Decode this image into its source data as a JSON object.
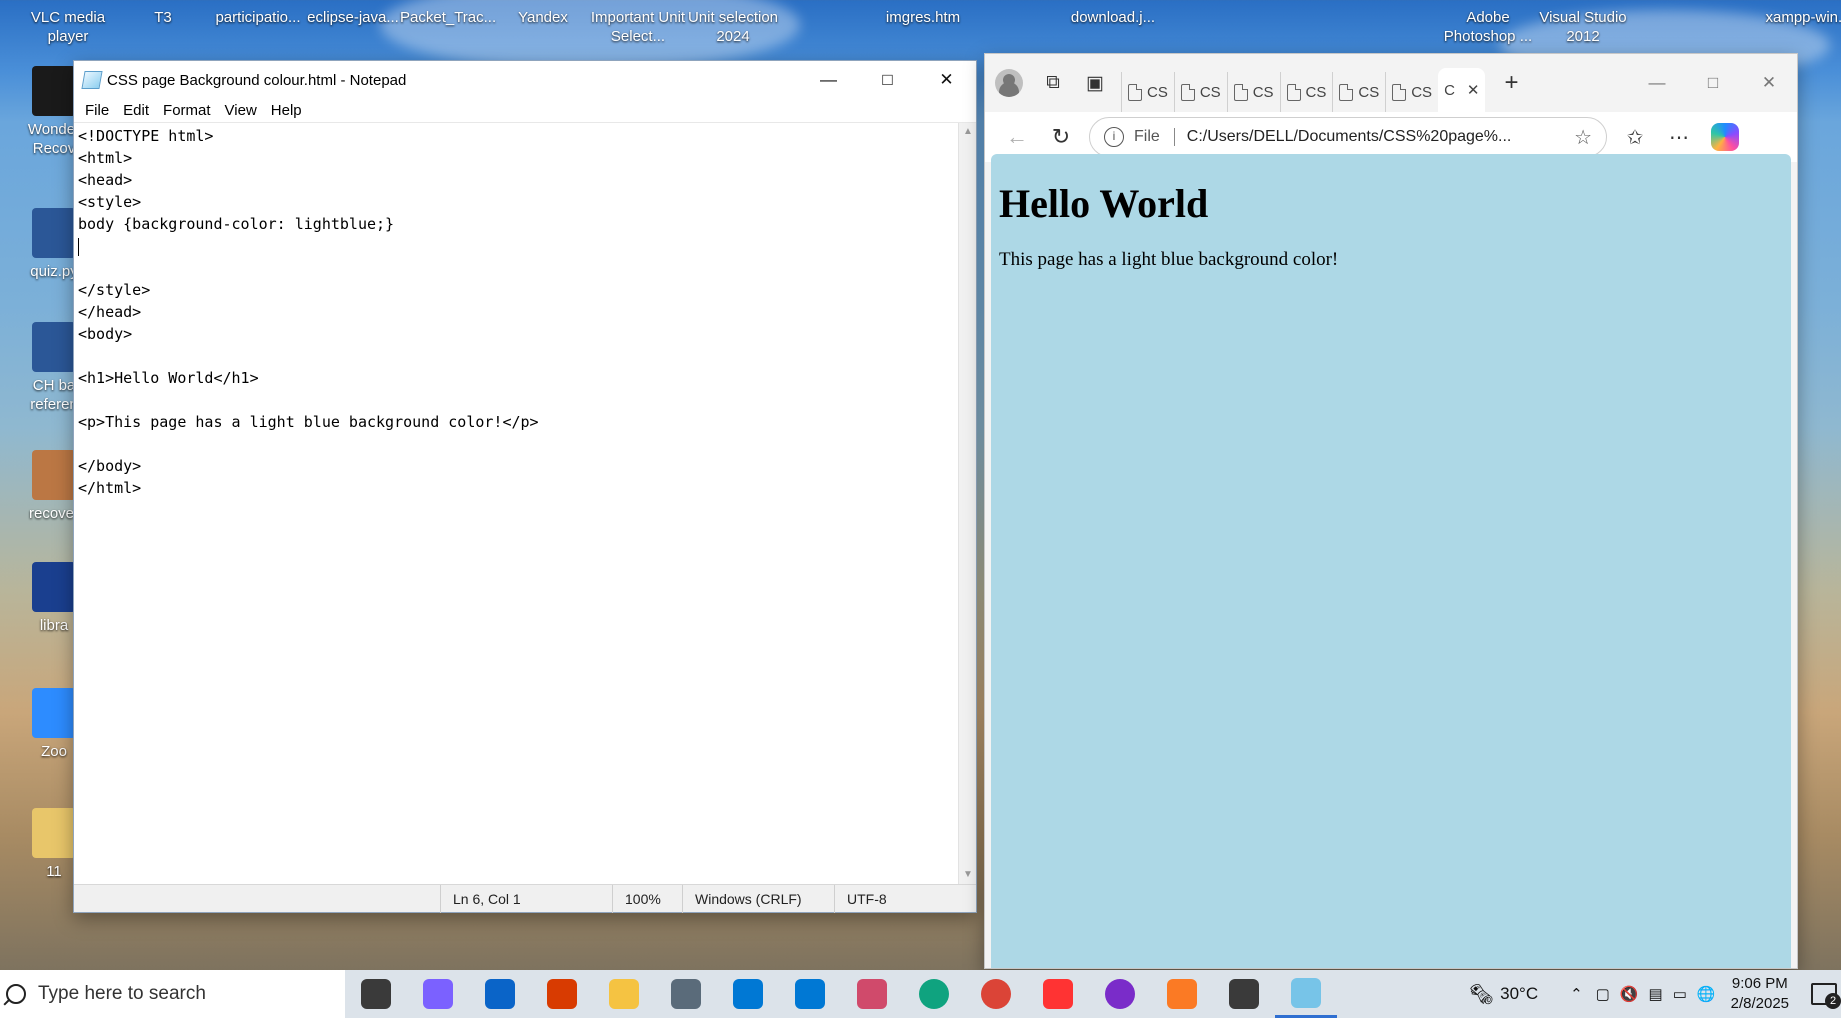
{
  "desktop": {
    "top_icons": [
      {
        "label": "VLC media player",
        "color": "#ff8800"
      },
      {
        "label": "T3",
        "color": "#f0c14b"
      },
      {
        "label": "participatio...",
        "color": "#2b5797"
      },
      {
        "label": "eclipse-java...",
        "color": "#2c2255"
      },
      {
        "label": "Packet_Trac...",
        "color": "#1b5fa8"
      },
      {
        "label": "Yandex",
        "color": "#ffffff"
      },
      {
        "label": "Important Unit Select...",
        "color": "#2b5797"
      },
      {
        "label": "Unit selection 2024",
        "color": "#2b5797"
      },
      {
        "label": "imgres.htm",
        "color": "#ffffff"
      },
      {
        "label": "download.j...",
        "color": "#ffffff"
      },
      {
        "label": "Adobe Photoshop ...",
        "color": "#31a8ff"
      },
      {
        "label": "Visual Studio 2012",
        "color": "#68217a"
      },
      {
        "label": "xampp-win...",
        "color": "#fb7a24"
      }
    ],
    "left_icons": [
      {
        "label": "Wonder Recov",
        "color": "#1a1a1a"
      },
      {
        "label": "quiz.py",
        "color": "#2b5797"
      },
      {
        "label": "CH ba referen",
        "color": "#2b5797"
      },
      {
        "label": "recover",
        "color": "#bb7744"
      },
      {
        "label": "libra",
        "color": "#1a3f8f"
      },
      {
        "label": "Zoo",
        "color": "#2d8cff"
      },
      {
        "label": "11",
        "color": "#e8c66a"
      }
    ]
  },
  "notepad": {
    "title": "CSS page Background colour.html - Notepad",
    "menu": [
      "File",
      "Edit",
      "Format",
      "View",
      "Help"
    ],
    "lines": [
      "<!DOCTYPE html>",
      "<html>",
      "<head>",
      "<style>",
      "body {background-color: lightblue;}",
      "",
      "",
      "</style>",
      "</head>",
      "<body>",
      "",
      "<h1>Hello World</h1>",
      "",
      "<p>This page has a light blue background color!</p>",
      "",
      "</body>",
      "</html>"
    ],
    "status": {
      "position": "Ln 6, Col 1",
      "zoom": "100%",
      "line_ending": "Windows (CRLF)",
      "encoding": "UTF-8"
    }
  },
  "edge": {
    "tab_labels": [
      "CS",
      "CS",
      "CS",
      "CS",
      "CS",
      "CS",
      "C"
    ],
    "address": {
      "scheme_label": "File",
      "url": "C:/Users/DELL/Documents/CSS%20page%..."
    },
    "page": {
      "heading": "Hello World",
      "paragraph": "This page has a light blue background color!",
      "background": "#add8e6"
    }
  },
  "taskbar": {
    "search_placeholder": "Type here to search",
    "apps": [
      {
        "name": "task-view",
        "color": "#3a3a3a"
      },
      {
        "name": "copilot",
        "color": "#7b61ff"
      },
      {
        "name": "outlook",
        "color": "#0a64c8"
      },
      {
        "name": "office",
        "color": "#d83b01"
      },
      {
        "name": "file-explorer",
        "color": "#f5c342"
      },
      {
        "name": "calculator",
        "color": "#5a6b7a"
      },
      {
        "name": "mail",
        "color": "#0078d4"
      },
      {
        "name": "azure",
        "color": "#0078d4"
      },
      {
        "name": "snipping-tool",
        "color": "#d04a6b"
      },
      {
        "name": "edge",
        "color": "#0fa37f"
      },
      {
        "name": "chrome",
        "color": "#db4437"
      },
      {
        "name": "yandex",
        "color": "#ff3333"
      },
      {
        "name": "game-bar",
        "color": "#7a2cc9"
      },
      {
        "name": "xampp",
        "color": "#fb7a24"
      },
      {
        "name": "settings",
        "color": "#3a3a3a"
      },
      {
        "name": "notepad",
        "color": "#77c4e8"
      }
    ],
    "weather": "30°C",
    "time": "9:06 PM",
    "date": "2/8/2025",
    "notification_count": "2"
  }
}
